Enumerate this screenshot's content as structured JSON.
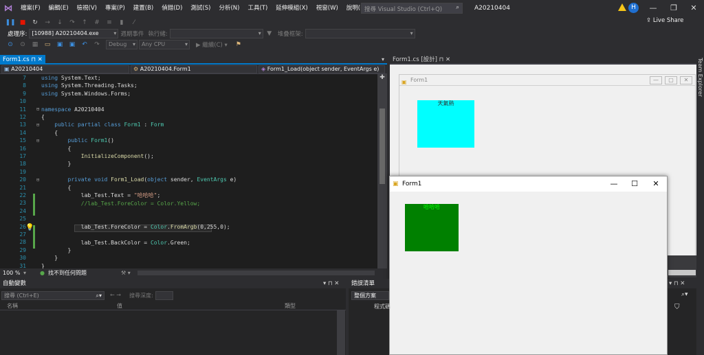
{
  "menubar": {
    "items": [
      "檔案(F)",
      "編輯(E)",
      "檢視(V)",
      "專案(P)",
      "建置(B)",
      "偵錯(D)",
      "測試(S)",
      "分析(N)",
      "工具(T)",
      "延伸模組(X)",
      "視窗(W)",
      "說明(H)"
    ],
    "search_placeholder": "搜尋 Visual Studio (Ctrl+Q)",
    "solution_name": "A20210404",
    "avatar_initial": "H",
    "live_share": "Live Share"
  },
  "toolbar2": {
    "process_label": "處理序:",
    "process_value": "[10988] A20210404.exe",
    "lifecycle_label": "週期事件",
    "thread_label": "執行緒:",
    "stackframe_label": "堆疊框架:"
  },
  "toolbar3": {
    "config": "Debug",
    "platform": "Any CPU",
    "continue_label": "繼續(C)"
  },
  "editor": {
    "tab_label": "Form1.cs",
    "nav_project": "A20210404",
    "nav_class": "A20210404.Form1",
    "nav_member": "Form1_Load(object sender, EventArgs e)",
    "zoom": "100 %",
    "status_text": "找不到任何問題",
    "line_numbers": [
      "7",
      "8",
      "9",
      "10",
      "11",
      "12",
      "13",
      "14",
      "15",
      "16",
      "17",
      "18",
      "19",
      "20",
      "21",
      "22",
      "23",
      "24",
      "25",
      "26",
      "27",
      "28",
      "29",
      "30",
      "31"
    ]
  },
  "designer": {
    "tab_label": "Form1.cs [設計]",
    "form_title": "Form1",
    "label_text": "天氣熱"
  },
  "runtime_form": {
    "title": "Form1",
    "label_text": "哈哈哈"
  },
  "autos": {
    "header": "自動變數",
    "search_placeholder": "搜尋 (Ctrl+E)",
    "depth_label": "搜尋深度:",
    "col_name": "名稱",
    "col_value": "值",
    "col_type": "類型"
  },
  "errorlist": {
    "header": "錯誤清單",
    "scope": "整個方案",
    "col_code": "程式碼"
  },
  "right_edge": "Team Explorer",
  "colors": {
    "accent": "#007acc",
    "designer_label_bg": "#00ffff",
    "runtime_label_bg": "#008000",
    "runtime_label_fg": "#00ff00"
  }
}
